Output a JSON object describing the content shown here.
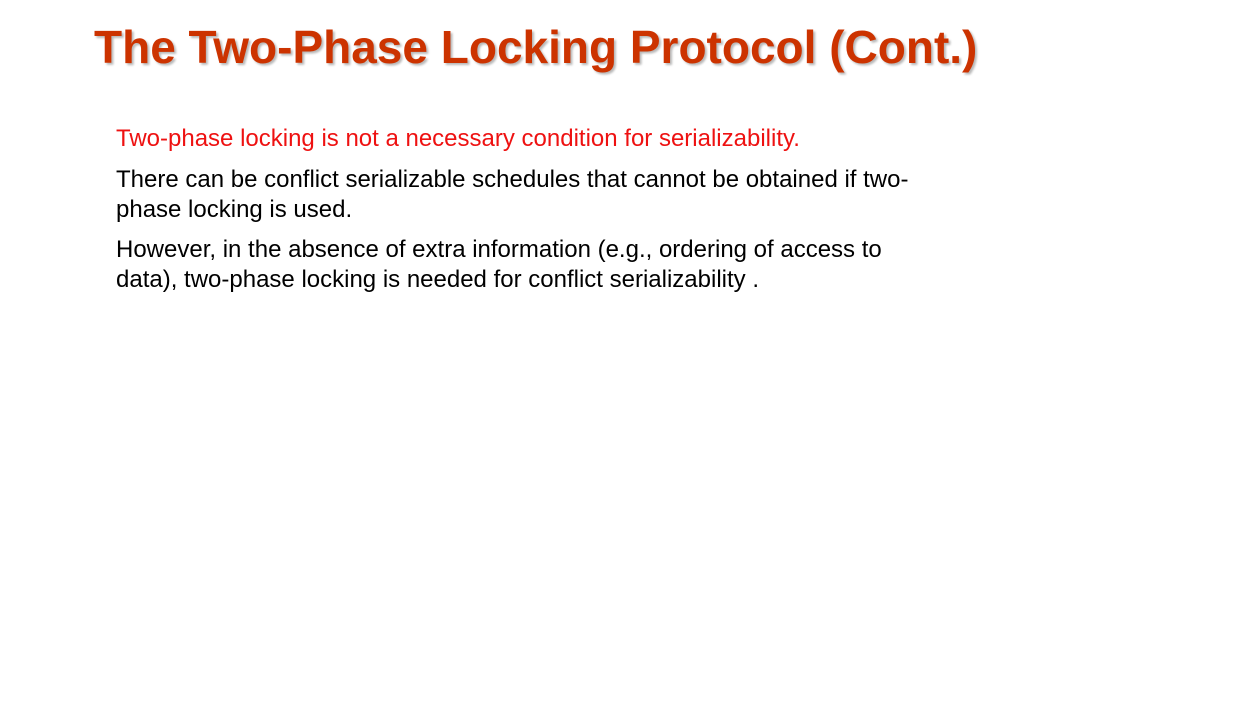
{
  "slide": {
    "title": "The Two-Phase Locking Protocol (Cont.)",
    "bullets": [
      "Two-phase locking is not a necessary condition for serializability.",
      "There can be conflict serializable schedules that cannot be obtained if two-phase locking is used.",
      "However, in the absence of extra information (e.g., ordering of  access to data), two-phase locking is needed for conflict serializability ."
    ]
  },
  "colors": {
    "title": "#cc3300",
    "highlight": "#ee1111",
    "text": "#000000",
    "background": "#ffffff"
  }
}
